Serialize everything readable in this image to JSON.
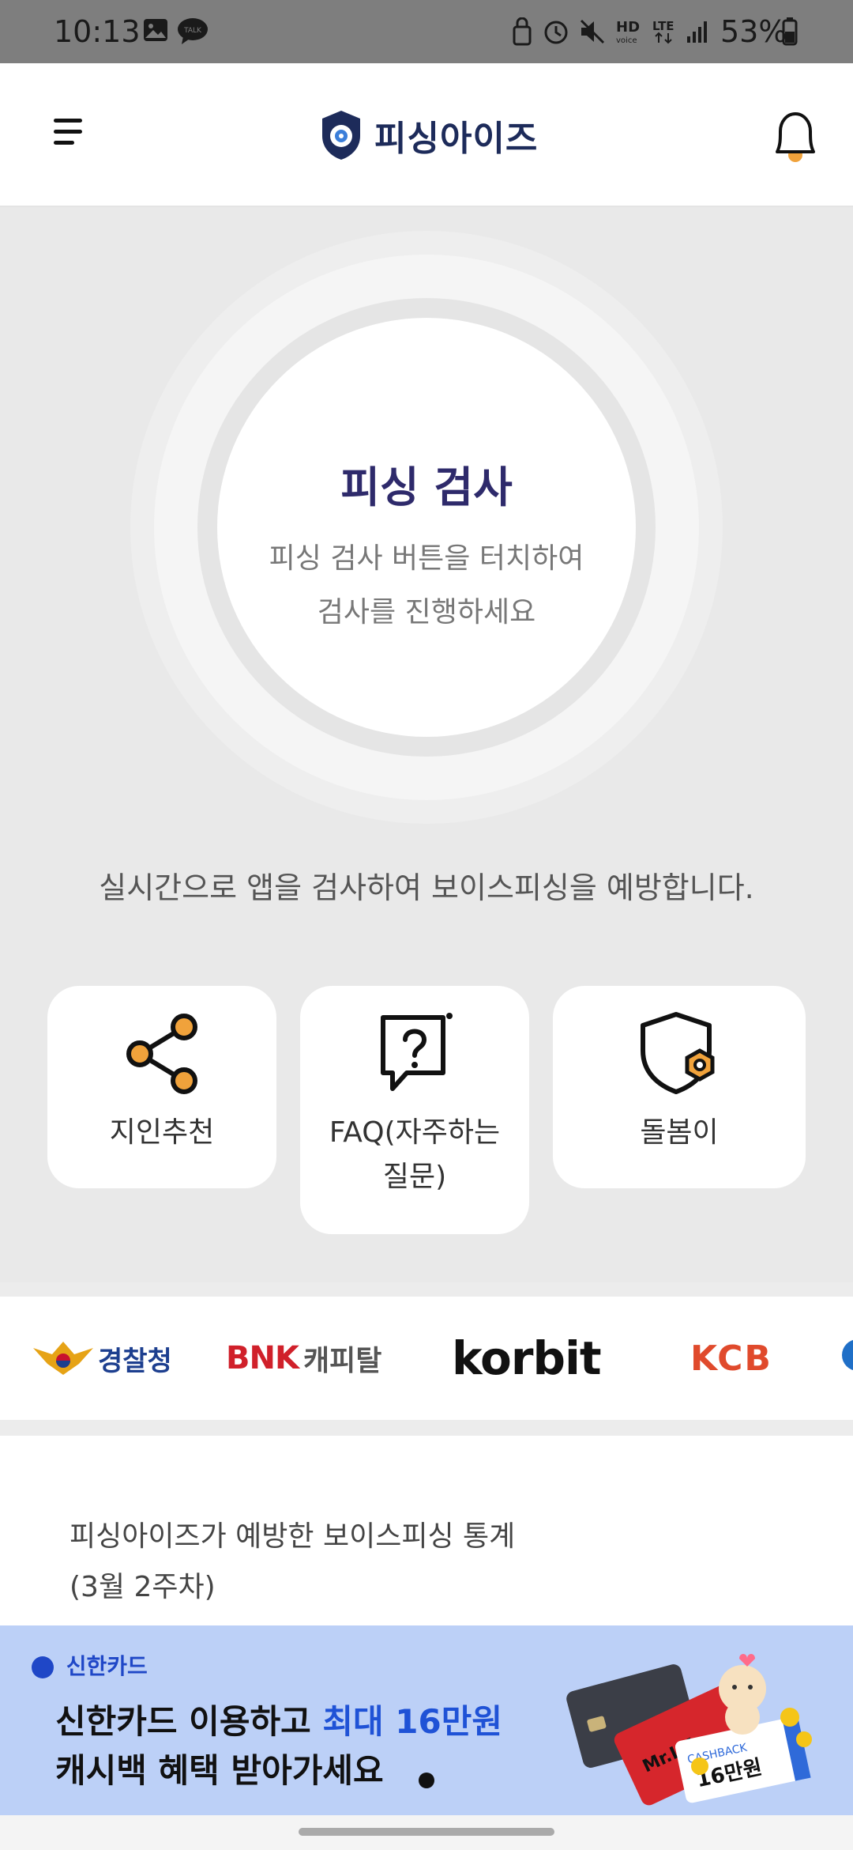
{
  "status_bar": {
    "time": "10:13",
    "battery": "53%",
    "icons": [
      "image-icon",
      "talk-icon",
      "lock-icon",
      "alarm-icon",
      "mute-icon",
      "hd-voice-icon",
      "lte-icon",
      "signal-icon",
      "battery-icon"
    ]
  },
  "header": {
    "brand": "피싱아이즈",
    "menu_icon": "hamburger-icon",
    "bell_icon": "bell-icon"
  },
  "scan": {
    "title": "피싱 검사",
    "desc_line1": "피싱 검사 버튼을 터치하여",
    "desc_line2": "검사를 진행하세요"
  },
  "tagline": "실시간으로 앱을 검사하여 보이스피싱을 예방합니다.",
  "cards": [
    {
      "label": "지인추천",
      "icon": "share-icon"
    },
    {
      "label_line1": "FAQ(자주하는",
      "label_line2": "질문)",
      "icon": "question-bubble-icon"
    },
    {
      "label": "돌봄이",
      "icon": "shield-gear-icon"
    }
  ],
  "partners": {
    "police": "경찰청",
    "bnk_a": "BNK",
    "bnk_b": "캐피탈",
    "korbit": "korbit",
    "kcb": "KCB"
  },
  "stats": {
    "title_line1": "피싱아이즈가 예방한 보이스피싱 통계",
    "title_line2": "(3월 2주차)"
  },
  "ad": {
    "brand": "신한카드",
    "line1_a": "신한카드 이용하고 ",
    "line1_b": "최대 16만원",
    "line2": "캐시백 혜택 받아가세요",
    "card_text": "Mr.Life",
    "cashback_label": "CASHBACK",
    "cashback_amount": "16만원"
  },
  "colors": {
    "brand_navy": "#1d2b5a",
    "scan_title": "#2e2a6b",
    "accent_orange": "#f0a23b",
    "ad_bg": "#bcd0f7",
    "ad_highlight": "#1f52d6"
  }
}
